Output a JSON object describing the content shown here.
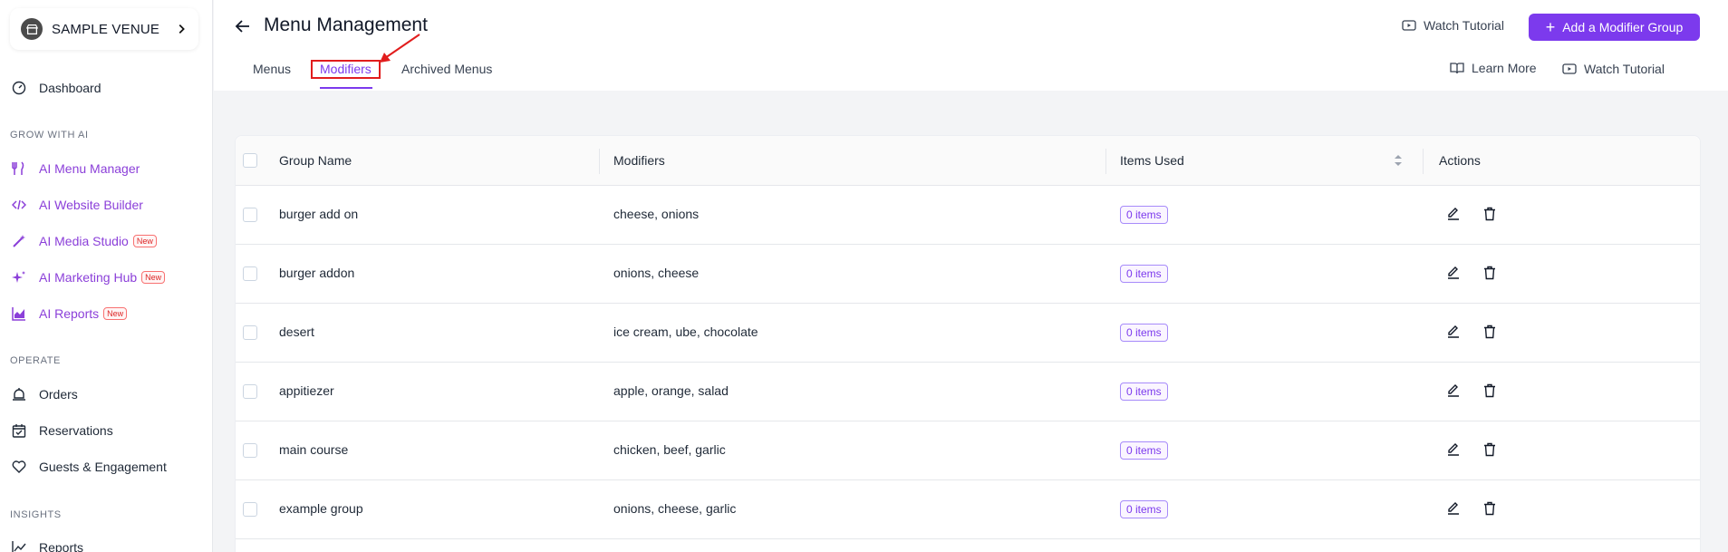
{
  "sidebar": {
    "venue_name": "SAMPLE VENUE",
    "dashboard": "Dashboard",
    "sections": {
      "grow": "GROW WITH AI",
      "operate": "OPERATE",
      "insights": "INSIGHTS"
    },
    "ai_items": [
      {
        "label": "AI Menu Manager",
        "badge": ""
      },
      {
        "label": "AI Website Builder",
        "badge": ""
      },
      {
        "label": "AI Media Studio",
        "badge": "New"
      },
      {
        "label": "AI Marketing Hub",
        "badge": "New"
      },
      {
        "label": "AI Reports",
        "badge": "New"
      }
    ],
    "operate_items": [
      "Orders",
      "Reservations",
      "Guests & Engagement"
    ],
    "insights_items": [
      "Reports"
    ]
  },
  "header": {
    "title": "Menu Management",
    "watch_tutorial": "Watch Tutorial",
    "add_button": "Add a Modifier Group",
    "learn_more": "Learn More",
    "watch_tutorial_tab": "Watch Tutorial",
    "tabs": [
      "Menus",
      "Modifiers",
      "Archived Menus"
    ],
    "active_tab": "Modifiers"
  },
  "table": {
    "columns": [
      "Group Name",
      "Modifiers",
      "Items Used",
      "Actions"
    ],
    "rows": [
      {
        "group": "burger add on",
        "modifiers": "cheese, onions",
        "items": "0 items"
      },
      {
        "group": "burger addon",
        "modifiers": "onions, cheese",
        "items": "0 items"
      },
      {
        "group": "desert",
        "modifiers": "ice cream, ube, chocolate",
        "items": "0 items"
      },
      {
        "group": "appitiezer",
        "modifiers": "apple, orange, salad",
        "items": "0 items"
      },
      {
        "group": "main course",
        "modifiers": "chicken, beef, garlic",
        "items": "0 items"
      },
      {
        "group": "example group",
        "modifiers": "onions, cheese, garlic",
        "items": "0 items"
      }
    ]
  },
  "colors": {
    "accent": "#7c3aed",
    "ai_text": "#8b3fd9",
    "annotation": "#e11d1d"
  }
}
